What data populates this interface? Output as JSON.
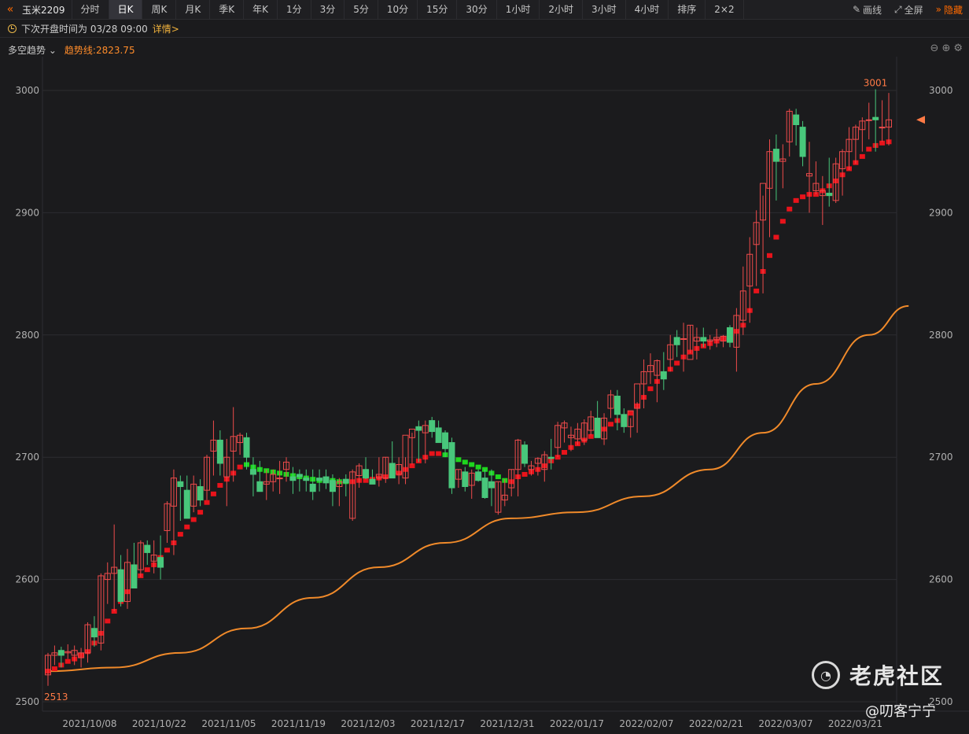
{
  "toolbar": {
    "symbol": "玉米2209",
    "items": [
      {
        "label": "分时",
        "name": "tab-timeshare"
      },
      {
        "label": "日K",
        "name": "tab-daily",
        "active": true
      },
      {
        "label": "周K",
        "name": "tab-weekly"
      },
      {
        "label": "月K",
        "name": "tab-monthly"
      },
      {
        "label": "季K",
        "name": "tab-quarterly"
      },
      {
        "label": "年K",
        "name": "tab-yearly"
      },
      {
        "label": "1分",
        "name": "tab-1min"
      },
      {
        "label": "3分",
        "name": "tab-3min"
      },
      {
        "label": "5分",
        "name": "tab-5min"
      },
      {
        "label": "10分",
        "name": "tab-10min"
      },
      {
        "label": "15分",
        "name": "tab-15min"
      },
      {
        "label": "30分",
        "name": "tab-30min"
      },
      {
        "label": "1小时",
        "name": "tab-1hour"
      },
      {
        "label": "2小时",
        "name": "tab-2hour"
      },
      {
        "label": "3小时",
        "name": "tab-3hour"
      },
      {
        "label": "4小时",
        "name": "tab-4hour"
      },
      {
        "label": "排序",
        "name": "tab-sort"
      },
      {
        "label": "2×2",
        "name": "tab-layout"
      }
    ],
    "draw": "画线",
    "fullscreen": "全屏",
    "hide": "隐藏"
  },
  "info": {
    "next_open": "下次开盘时间为 03/28 09:00",
    "detail": "详情>"
  },
  "indicator": {
    "name": "多空趋势",
    "value": "趋势线:2823.75"
  },
  "colors": {
    "up": "#ee4b4b",
    "down": "#48c77b",
    "trend_red": "#e8131b",
    "trend_green": "#1ed61e",
    "trend_line": "#f08a2a",
    "marker": "#ff7a45"
  },
  "chart_data": {
    "type": "candlestick",
    "y_ticks": [
      2500,
      2600,
      2700,
      2800,
      2900,
      3000
    ],
    "ylim": [
      2500,
      3000
    ],
    "x_labels": [
      "2021/10/08",
      "2021/10/22",
      "2021/11/05",
      "2021/11/19",
      "2021/12/03",
      "2021/12/17",
      "2021/12/31",
      "2022/01/17",
      "2022/02/07",
      "2022/02/21",
      "2022/03/07",
      "2022/03/21"
    ],
    "max_label": "3001",
    "min_label": "2513",
    "ohlc": [
      [
        2522,
        2540,
        2513,
        2538
      ],
      [
        2538,
        2546,
        2530,
        2540
      ],
      [
        2542,
        2545,
        2528,
        2538
      ],
      [
        2540,
        2547,
        2535,
        2541
      ],
      [
        2538,
        2546,
        2530,
        2542
      ],
      [
        2536,
        2544,
        2528,
        2540
      ],
      [
        2540,
        2565,
        2532,
        2563
      ],
      [
        2560,
        2570,
        2545,
        2553
      ],
      [
        2548,
        2605,
        2542,
        2603
      ],
      [
        2600,
        2614,
        2580,
        2605
      ],
      [
        2605,
        2645,
        2574,
        2610
      ],
      [
        2608,
        2620,
        2578,
        2582
      ],
      [
        2582,
        2625,
        2576,
        2614
      ],
      [
        2612,
        2630,
        2596,
        2593
      ],
      [
        2608,
        2632,
        2602,
        2630
      ],
      [
        2628,
        2632,
        2612,
        2622
      ],
      [
        2615,
        2632,
        2605,
        2620
      ],
      [
        2618,
        2636,
        2600,
        2610
      ],
      [
        2640,
        2664,
        2630,
        2662
      ],
      [
        2660,
        2690,
        2620,
        2683
      ],
      [
        2680,
        2685,
        2648,
        2676
      ],
      [
        2673,
        2685,
        2653,
        2650
      ],
      [
        2660,
        2685,
        2655,
        2678
      ],
      [
        2676,
        2682,
        2660,
        2665
      ],
      [
        2673,
        2702,
        2665,
        2700
      ],
      [
        2705,
        2730,
        2685,
        2714
      ],
      [
        2714,
        2722,
        2685,
        2695
      ],
      [
        2684,
        2715,
        2660,
        2700
      ],
      [
        2705,
        2741,
        2680,
        2717
      ],
      [
        2712,
        2720,
        2702,
        2718
      ],
      [
        2716,
        2720,
        2690,
        2700
      ],
      [
        2690,
        2700,
        2668,
        2686
      ],
      [
        2680,
        2697,
        2672,
        2672
      ],
      [
        2678,
        2690,
        2665,
        2680
      ],
      [
        2680,
        2690,
        2672,
        2686
      ],
      [
        2683,
        2697,
        2670,
        2683
      ],
      [
        2690,
        2700,
        2680,
        2696
      ],
      [
        2684,
        2692,
        2670,
        2681
      ],
      [
        2686,
        2690,
        2672,
        2684
      ],
      [
        2683,
        2690,
        2672,
        2681
      ],
      [
        2678,
        2690,
        2665,
        2672
      ],
      [
        2683,
        2690,
        2672,
        2681
      ],
      [
        2684,
        2690,
        2674,
        2679
      ],
      [
        2681,
        2686,
        2660,
        2672
      ],
      [
        2676,
        2683,
        2660,
        2680
      ],
      [
        2682,
        2686,
        2668,
        2679
      ],
      [
        2650,
        2690,
        2648,
        2688
      ],
      [
        2685,
        2695,
        2675,
        2693
      ],
      [
        2690,
        2700,
        2682,
        2683
      ],
      [
        2682,
        2690,
        2678,
        2678
      ],
      [
        2683,
        2700,
        2676,
        2686
      ],
      [
        2683,
        2700,
        2679,
        2700
      ],
      [
        2695,
        2713,
        2683,
        2683
      ],
      [
        2686,
        2700,
        2678,
        2694
      ],
      [
        2683,
        2700,
        2678,
        2718
      ],
      [
        2716,
        2720,
        2694,
        2723
      ],
      [
        2725,
        2730,
        2696,
        2722
      ],
      [
        2720,
        2730,
        2695,
        2726
      ],
      [
        2730,
        2733,
        2716,
        2721
      ],
      [
        2724,
        2730,
        2713,
        2712
      ],
      [
        2720,
        2722,
        2700,
        2707
      ],
      [
        2712,
        2716,
        2670,
        2675
      ],
      [
        2682,
        2690,
        2675,
        2690
      ],
      [
        2688,
        2692,
        2672,
        2676
      ],
      [
        2677,
        2690,
        2666,
        2687
      ],
      [
        2688,
        2690,
        2680,
        2681
      ],
      [
        2683,
        2690,
        2666,
        2667
      ],
      [
        2680,
        2690,
        2660,
        2675
      ],
      [
        2655,
        2680,
        2653,
        2680
      ],
      [
        2665,
        2682,
        2660,
        2669
      ],
      [
        2675,
        2690,
        2668,
        2690
      ],
      [
        2690,
        2715,
        2668,
        2714
      ],
      [
        2710,
        2713,
        2692,
        2695
      ],
      [
        2690,
        2697,
        2685,
        2693
      ],
      [
        2695,
        2700,
        2685,
        2699
      ],
      [
        2690,
        2705,
        2680,
        2702
      ],
      [
        2700,
        2715,
        2690,
        2699
      ],
      [
        2708,
        2729,
        2700,
        2726
      ],
      [
        2724,
        2730,
        2712,
        2728
      ],
      [
        2716,
        2725,
        2705,
        2718
      ],
      [
        2715,
        2728,
        2710,
        2723
      ],
      [
        2714,
        2731,
        2710,
        2728
      ],
      [
        2722,
        2738,
        2718,
        2733
      ],
      [
        2732,
        2746,
        2716,
        2716
      ],
      [
        2715,
        2736,
        2710,
        2732
      ],
      [
        2740,
        2755,
        2732,
        2751
      ],
      [
        2750,
        2755,
        2722,
        2735
      ],
      [
        2735,
        2740,
        2720,
        2725
      ],
      [
        2725,
        2732,
        2716,
        2738
      ],
      [
        2740,
        2745,
        2720,
        2760
      ],
      [
        2760,
        2780,
        2740,
        2770
      ],
      [
        2770,
        2785,
        2760,
        2775
      ],
      [
        2767,
        2780,
        2745,
        2779
      ],
      [
        2770,
        2786,
        2755,
        2764
      ],
      [
        2780,
        2800,
        2770,
        2792
      ],
      [
        2798,
        2804,
        2782,
        2792
      ],
      [
        2797,
        2810,
        2770,
        2797
      ],
      [
        2780,
        2808,
        2785,
        2808
      ],
      [
        2795,
        2806,
        2780,
        2798
      ],
      [
        2798,
        2806,
        2790,
        2795
      ],
      [
        2795,
        2800,
        2788,
        2796
      ],
      [
        2796,
        2805,
        2790,
        2798
      ],
      [
        2795,
        2800,
        2790,
        2799
      ],
      [
        2806,
        2808,
        2790,
        2794
      ],
      [
        2790,
        2822,
        2770,
        2816
      ],
      [
        2812,
        2856,
        2800,
        2836
      ],
      [
        2840,
        2880,
        2810,
        2866
      ],
      [
        2874,
        2902,
        2840,
        2892
      ],
      [
        2894,
        2914,
        2834,
        2924
      ],
      [
        2920,
        2960,
        2880,
        2950
      ],
      [
        2952,
        2964,
        2910,
        2942
      ],
      [
        2942,
        2956,
        2920,
        2944
      ],
      [
        2958,
        2985,
        2946,
        2983
      ],
      [
        2980,
        2985,
        2955,
        2972
      ],
      [
        2970,
        2975,
        2938,
        2946
      ],
      [
        2930,
        2958,
        2900,
        2932
      ],
      [
        2918,
        2942,
        2915,
        2924
      ],
      [
        2914,
        2930,
        2890,
        2918
      ],
      [
        2916,
        2945,
        2905,
        2914
      ],
      [
        2910,
        2945,
        2908,
        2940
      ],
      [
        2936,
        2952,
        2914,
        2950
      ],
      [
        2950,
        2970,
        2935,
        2960
      ],
      [
        2960,
        2972,
        2940,
        2970
      ],
      [
        2968,
        2978,
        2950,
        2975
      ],
      [
        2976,
        2990,
        2960,
        2976
      ],
      [
        2978,
        3001,
        2950,
        2976
      ],
      [
        2970,
        2992,
        2958,
        2970
      ],
      [
        2970,
        2998,
        2955,
        2976
      ]
    ],
    "trend": [
      [
        2525,
        "r"
      ],
      [
        2527,
        "r"
      ],
      [
        2530,
        "r"
      ],
      [
        2533,
        "r"
      ],
      [
        2535,
        "r"
      ],
      [
        2538,
        "r"
      ],
      [
        2541,
        "r"
      ],
      [
        2548,
        "r"
      ],
      [
        2556,
        "r"
      ],
      [
        2566,
        "r"
      ],
      [
        2574,
        "r"
      ],
      [
        2582,
        "r"
      ],
      [
        2590,
        "r"
      ],
      [
        2597,
        "r"
      ],
      [
        2603,
        "r"
      ],
      [
        2608,
        "r"
      ],
      [
        2612,
        "r"
      ],
      [
        2618,
        "r"
      ],
      [
        2624,
        "r"
      ],
      [
        2630,
        "r"
      ],
      [
        2637,
        "r"
      ],
      [
        2643,
        "r"
      ],
      [
        2649,
        "r"
      ],
      [
        2655,
        "r"
      ],
      [
        2663,
        "r"
      ],
      [
        2670,
        "r"
      ],
      [
        2677,
        "r"
      ],
      [
        2682,
        "r"
      ],
      [
        2687,
        "r"
      ],
      [
        2692,
        "r"
      ],
      [
        2694,
        "g"
      ],
      [
        2692,
        "g"
      ],
      [
        2690,
        "g"
      ],
      [
        2689,
        "g"
      ],
      [
        2688,
        "g"
      ],
      [
        2687,
        "g"
      ],
      [
        2686,
        "g"
      ],
      [
        2685,
        "g"
      ],
      [
        2684,
        "g"
      ],
      [
        2683,
        "g"
      ],
      [
        2682,
        "g"
      ],
      [
        2681,
        "g"
      ],
      [
        2681,
        "g"
      ],
      [
        2681,
        "g"
      ],
      [
        2680,
        "g"
      ],
      [
        2680,
        "g"
      ],
      [
        2680,
        "r"
      ],
      [
        2681,
        "r"
      ],
      [
        2681,
        "r"
      ],
      [
        2682,
        "r"
      ],
      [
        2683,
        "r"
      ],
      [
        2684,
        "r"
      ],
      [
        2685,
        "r"
      ],
      [
        2687,
        "r"
      ],
      [
        2690,
        "r"
      ],
      [
        2693,
        "r"
      ],
      [
        2697,
        "r"
      ],
      [
        2700,
        "r"
      ],
      [
        2703,
        "r"
      ],
      [
        2703,
        "r"
      ],
      [
        2702,
        "g"
      ],
      [
        2700,
        "g"
      ],
      [
        2698,
        "g"
      ],
      [
        2696,
        "g"
      ],
      [
        2694,
        "g"
      ],
      [
        2692,
        "g"
      ],
      [
        2690,
        "g"
      ],
      [
        2687,
        "g"
      ],
      [
        2684,
        "g"
      ],
      [
        2681,
        "g"
      ],
      [
        2680,
        "r"
      ],
      [
        2684,
        "r"
      ],
      [
        2686,
        "r"
      ],
      [
        2688,
        "r"
      ],
      [
        2690,
        "r"
      ],
      [
        2693,
        "r"
      ],
      [
        2697,
        "r"
      ],
      [
        2700,
        "r"
      ],
      [
        2704,
        "r"
      ],
      [
        2708,
        "r"
      ],
      [
        2711,
        "r"
      ],
      [
        2714,
        "r"
      ],
      [
        2717,
        "r"
      ],
      [
        2720,
        "r"
      ],
      [
        2723,
        "r"
      ],
      [
        2727,
        "r"
      ],
      [
        2730,
        "r"
      ],
      [
        2733,
        "r"
      ],
      [
        2736,
        "r"
      ],
      [
        2742,
        "r"
      ],
      [
        2749,
        "r"
      ],
      [
        2756,
        "r"
      ],
      [
        2762,
        "r"
      ],
      [
        2767,
        "r"
      ],
      [
        2772,
        "r"
      ],
      [
        2777,
        "r"
      ],
      [
        2782,
        "r"
      ],
      [
        2786,
        "r"
      ],
      [
        2789,
        "r"
      ],
      [
        2791,
        "r"
      ],
      [
        2793,
        "r"
      ],
      [
        2795,
        "r"
      ],
      [
        2797,
        "r"
      ],
      [
        2799,
        "r"
      ],
      [
        2803,
        "r"
      ],
      [
        2808,
        "r"
      ],
      [
        2820,
        "r"
      ],
      [
        2836,
        "r"
      ],
      [
        2852,
        "r"
      ],
      [
        2865,
        "r"
      ],
      [
        2880,
        "r"
      ],
      [
        2893,
        "r"
      ],
      [
        2903,
        "r"
      ],
      [
        2910,
        "r"
      ],
      [
        2913,
        "r"
      ],
      [
        2915,
        "r"
      ],
      [
        2915,
        "r"
      ],
      [
        2918,
        "r"
      ],
      [
        2922,
        "r"
      ],
      [
        2926,
        "r"
      ],
      [
        2931,
        "r"
      ],
      [
        2936,
        "r"
      ],
      [
        2941,
        "r"
      ],
      [
        2946,
        "r"
      ],
      [
        2952,
        "r"
      ],
      [
        2955,
        "r"
      ],
      [
        2957,
        "r"
      ],
      [
        2958,
        "r"
      ]
    ],
    "trend_line": [
      [
        0,
        2525
      ],
      [
        10,
        2528
      ],
      [
        20,
        2540
      ],
      [
        30,
        2560
      ],
      [
        40,
        2585
      ],
      [
        50,
        2610
      ],
      [
        60,
        2630
      ],
      [
        70,
        2650
      ],
      [
        80,
        2655
      ],
      [
        90,
        2668
      ],
      [
        100,
        2690
      ],
      [
        108,
        2720
      ],
      [
        116,
        2760
      ],
      [
        124,
        2800
      ],
      [
        130,
        2823.75
      ]
    ]
  }
}
